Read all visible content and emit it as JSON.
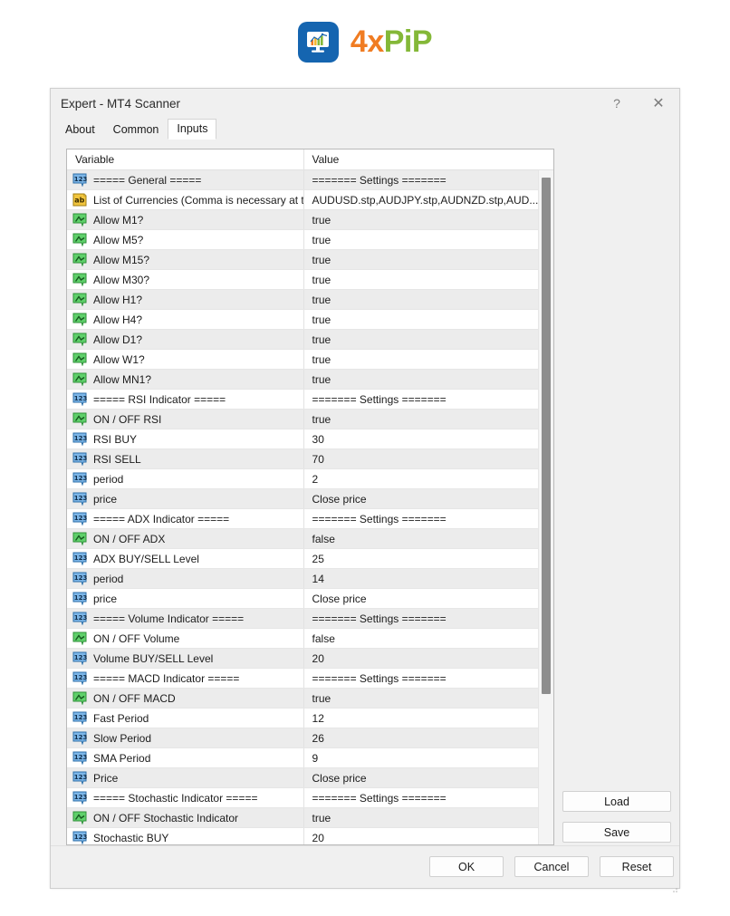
{
  "brand": {
    "logo_icon": "chart-monitor-icon",
    "name_part1": "4x",
    "name_part2": "PiP",
    "color_orange": "#f07c22",
    "color_green": "#84b838",
    "logo_bg": "#1565b0"
  },
  "dialog": {
    "title": "Expert - MT4 Scanner",
    "help_label": "?",
    "close_label": "✕"
  },
  "tabs": [
    {
      "label": "About",
      "active": false
    },
    {
      "label": "Common",
      "active": false
    },
    {
      "label": "Inputs",
      "active": true
    }
  ],
  "grid": {
    "headers": {
      "variable": "Variable",
      "value": "Value"
    },
    "rows": [
      {
        "icon": "int-type-icon",
        "variable": "===== General =====",
        "value": "======= Settings ======="
      },
      {
        "icon": "string-type-icon",
        "variable": "List of Currencies (Comma is necessary at t..",
        "value": "AUDUSD.stp,AUDJPY.stp,AUDNZD.stp,AUD..."
      },
      {
        "icon": "bool-type-icon",
        "variable": "Allow M1?",
        "value": "true"
      },
      {
        "icon": "bool-type-icon",
        "variable": "Allow M5?",
        "value": "true"
      },
      {
        "icon": "bool-type-icon",
        "variable": "Allow M15?",
        "value": "true"
      },
      {
        "icon": "bool-type-icon",
        "variable": "Allow M30?",
        "value": "true"
      },
      {
        "icon": "bool-type-icon",
        "variable": "Allow H1?",
        "value": "true"
      },
      {
        "icon": "bool-type-icon",
        "variable": "Allow H4?",
        "value": "true"
      },
      {
        "icon": "bool-type-icon",
        "variable": "Allow D1?",
        "value": "true"
      },
      {
        "icon": "bool-type-icon",
        "variable": "Allow W1?",
        "value": "true"
      },
      {
        "icon": "bool-type-icon",
        "variable": "Allow MN1?",
        "value": "true"
      },
      {
        "icon": "int-type-icon",
        "variable": "===== RSI Indicator =====",
        "value": "======= Settings ======="
      },
      {
        "icon": "bool-type-icon",
        "variable": "ON / OFF RSI",
        "value": "true"
      },
      {
        "icon": "int-type-icon",
        "variable": "RSI BUY",
        "value": "30"
      },
      {
        "icon": "int-type-icon",
        "variable": "RSI SELL",
        "value": "70"
      },
      {
        "icon": "int-type-icon",
        "variable": "period",
        "value": "2"
      },
      {
        "icon": "int-type-icon",
        "variable": "price",
        "value": "Close price"
      },
      {
        "icon": "int-type-icon",
        "variable": "===== ADX Indicator =====",
        "value": "======= Settings ======="
      },
      {
        "icon": "bool-type-icon",
        "variable": "ON / OFF ADX",
        "value": "false"
      },
      {
        "icon": "int-type-icon",
        "variable": "ADX BUY/SELL Level",
        "value": "25"
      },
      {
        "icon": "int-type-icon",
        "variable": "period",
        "value": "14"
      },
      {
        "icon": "int-type-icon",
        "variable": "price",
        "value": "Close price"
      },
      {
        "icon": "int-type-icon",
        "variable": "===== Volume Indicator =====",
        "value": "======= Settings ======="
      },
      {
        "icon": "bool-type-icon",
        "variable": "ON / OFF Volume",
        "value": "false"
      },
      {
        "icon": "int-type-icon",
        "variable": "Volume BUY/SELL Level",
        "value": "20"
      },
      {
        "icon": "int-type-icon",
        "variable": "===== MACD Indicator =====",
        "value": "======= Settings ======="
      },
      {
        "icon": "bool-type-icon",
        "variable": "ON / OFF MACD",
        "value": "true"
      },
      {
        "icon": "int-type-icon",
        "variable": "Fast Period",
        "value": "12"
      },
      {
        "icon": "int-type-icon",
        "variable": "Slow Period",
        "value": "26"
      },
      {
        "icon": "int-type-icon",
        "variable": "SMA Period",
        "value": "9"
      },
      {
        "icon": "int-type-icon",
        "variable": "Price",
        "value": "Close price"
      },
      {
        "icon": "int-type-icon",
        "variable": "===== Stochastic Indicator =====",
        "value": "======= Settings ======="
      },
      {
        "icon": "bool-type-icon",
        "variable": "ON / OFF Stochastic Indicator",
        "value": "true"
      },
      {
        "icon": "int-type-icon",
        "variable": "Stochastic BUY",
        "value": "20"
      }
    ]
  },
  "side_buttons": {
    "load": "Load",
    "save": "Save"
  },
  "bottom_buttons": {
    "ok": "OK",
    "cancel": "Cancel",
    "reset": "Reset"
  }
}
